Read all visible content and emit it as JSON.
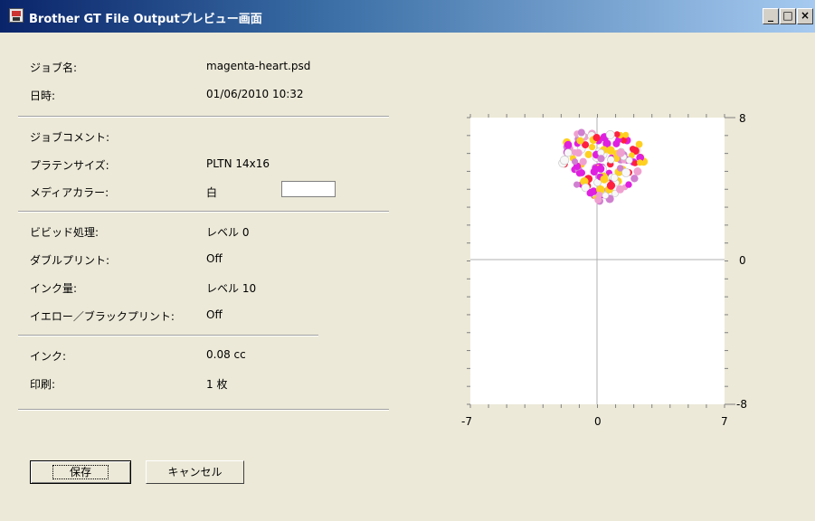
{
  "window": {
    "title": "Brother GT File Outputプレビュー画面",
    "minimize": "_",
    "maximize": "□",
    "close": "×"
  },
  "fields": {
    "job_name": {
      "label": "ジョブ名:",
      "value": "magenta-heart.psd"
    },
    "datetime": {
      "label": "日時:",
      "value": "01/06/2010 10:32"
    },
    "job_comment": {
      "label": "ジョブコメント:",
      "value": ""
    },
    "platen_size": {
      "label": "プラテンサイズ:",
      "value": "PLTN 14x16"
    },
    "media_color": {
      "label": "メディアカラー:",
      "value": "白",
      "swatch_color": "#ffffff"
    },
    "vivid": {
      "label": "ビビッド処理:",
      "value": "レベル 0"
    },
    "double_print": {
      "label": "ダブルプリント:",
      "value": "Off"
    },
    "ink_amount": {
      "label": "インク量:",
      "value": "レベル 10"
    },
    "yellow_black": {
      "label": "イエロー／ブラックプリント:",
      "value": "Off"
    },
    "ink": {
      "label": "インク:",
      "value": "0.08 cc"
    },
    "print": {
      "label": "印刷:",
      "value": "1 枚"
    }
  },
  "buttons": {
    "save": "保存",
    "cancel": "キャンセル"
  },
  "preview": {
    "x_min_label": "-7",
    "x_zero_label": "0",
    "x_max_label": "7",
    "y_max_label": "8",
    "y_zero_label": "0",
    "y_min_label": "-8",
    "palette": [
      "#e020e0",
      "#d080d0",
      "#f0a0d0",
      "#ff2040",
      "#ffd020",
      "#f8f8f8"
    ]
  }
}
